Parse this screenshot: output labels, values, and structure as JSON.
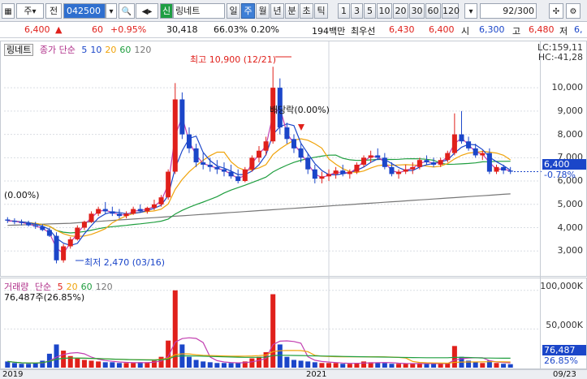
{
  "toolbar": {
    "market": "주",
    "mode": "전",
    "code": "042500",
    "badge": "신",
    "name": "링네트",
    "periods": [
      "일",
      "주",
      "월",
      "년",
      "분",
      "초",
      "틱"
    ],
    "active_period": "주",
    "units": [
      "1",
      "3",
      "5",
      "10",
      "20",
      "30",
      "60",
      "120"
    ],
    "count": "92",
    "count_total": "/300"
  },
  "quote": {
    "price": "6,400",
    "change": "60",
    "change_pct": "+0.95%",
    "volume": "30,418",
    "ratio": "66.03%",
    "turnover": "0.20%",
    "amount": "194백만",
    "best_ask_label": "최우선",
    "best_ask": "6,430",
    "best_bid": "6,400",
    "open_label": "시",
    "open": "6,300",
    "high_label": "고",
    "high": "6,480",
    "low_label": "저",
    "low": "6,"
  },
  "price_panel": {
    "title": "링네트",
    "legend_main": "종가 단순",
    "ma": [
      {
        "label": "5",
        "color": "#1b46c9"
      },
      {
        "label": "10",
        "color": "#1b46c9"
      },
      {
        "label": "20",
        "color": "#f0a30a"
      },
      {
        "label": "60",
        "color": "#1f9e3f"
      },
      {
        "label": "120",
        "color": "#777777"
      }
    ],
    "y_ticks": [
      "10,000",
      "9,000",
      "8,000",
      "7,000",
      "6,000",
      "5,000",
      "4,000",
      "3,000"
    ],
    "lc": "LC:159,11",
    "hc": "HC:-41,28",
    "current_price_tag": "6,400",
    "current_pct_tag": "-0.78%",
    "high_note": "최고 10,900 (12/21)",
    "low_note": "최저 2,470 (03/16)",
    "dividend_note": "배당락(0.00%)",
    "left_note": "(0.00%)"
  },
  "volume_panel": {
    "title": "거래량",
    "legend_main": "단순",
    "ma": [
      {
        "label": "5",
        "color": "#e0201b"
      },
      {
        "label": "20",
        "color": "#f0a30a"
      },
      {
        "label": "60",
        "color": "#1f9e3f"
      },
      {
        "label": "120",
        "color": "#777777"
      }
    ],
    "current_volume": "76,487주(26.85%)",
    "y_ticks": [
      "100,000K",
      "50,000K"
    ],
    "tag_value": "76,487",
    "tag_pct": "26.85%"
  },
  "x_axis": {
    "labels": [
      "2019",
      "2021",
      "09/23"
    ]
  },
  "chart_data": {
    "type": "candlestick",
    "candles": [
      [
        4350,
        4450,
        4200,
        4300
      ],
      [
        4300,
        4400,
        4150,
        4250
      ],
      [
        4250,
        4350,
        4100,
        4200
      ],
      [
        4200,
        4300,
        4050,
        4100
      ],
      [
        4100,
        4250,
        3950,
        4050
      ],
      [
        4050,
        4150,
        3850,
        3900
      ],
      [
        3900,
        4000,
        3600,
        3650
      ],
      [
        3650,
        3800,
        2470,
        2600
      ],
      [
        2600,
        3300,
        2500,
        3200
      ],
      [
        3200,
        3600,
        3100,
        3500
      ],
      [
        3500,
        4100,
        3450,
        4000
      ],
      [
        4000,
        4300,
        3900,
        4250
      ],
      [
        4250,
        4700,
        4200,
        4600
      ],
      [
        4600,
        4900,
        4500,
        4800
      ],
      [
        4800,
        5100,
        4600,
        4700
      ],
      [
        4700,
        4900,
        4500,
        4600
      ],
      [
        4600,
        4800,
        4400,
        4500
      ],
      [
        4500,
        4700,
        4400,
        4600
      ],
      [
        4600,
        4900,
        4550,
        4800
      ],
      [
        4800,
        5000,
        4650,
        4700
      ],
      [
        4700,
        4900,
        4600,
        4850
      ],
      [
        4850,
        5200,
        4750,
        5000
      ],
      [
        5000,
        5400,
        4900,
        5300
      ],
      [
        5300,
        6500,
        5200,
        6400
      ],
      [
        6400,
        10200,
        6300,
        9500
      ],
      [
        9500,
        9800,
        7800,
        8000
      ],
      [
        8000,
        8300,
        7200,
        7400
      ],
      [
        7400,
        7600,
        6600,
        6800
      ],
      [
        6800,
        7200,
        6500,
        6700
      ],
      [
        6700,
        7000,
        6400,
        6600
      ],
      [
        6600,
        6900,
        6300,
        6500
      ],
      [
        6500,
        6800,
        6200,
        6400
      ],
      [
        6400,
        6700,
        6100,
        6200
      ],
      [
        6200,
        6500,
        5900,
        6000
      ],
      [
        6000,
        6600,
        5950,
        6500
      ],
      [
        6500,
        7100,
        6400,
        7000
      ],
      [
        7000,
        7500,
        6800,
        7300
      ],
      [
        7300,
        7900,
        7100,
        7700
      ],
      [
        7700,
        10900,
        7600,
        10000
      ],
      [
        10000,
        10400,
        8000,
        8300
      ],
      [
        8300,
        8500,
        7600,
        7800
      ],
      [
        7800,
        8000,
        7200,
        7400
      ],
      [
        7400,
        7600,
        6800,
        7000
      ],
      [
        7000,
        7200,
        6300,
        6500
      ],
      [
        6500,
        6700,
        5900,
        6100
      ],
      [
        6100,
        6400,
        5900,
        6200
      ],
      [
        6200,
        6500,
        6000,
        6300
      ],
      [
        6300,
        6600,
        6100,
        6450
      ],
      [
        6450,
        6700,
        6200,
        6300
      ],
      [
        6300,
        6500,
        6100,
        6400
      ],
      [
        6400,
        6800,
        6300,
        6700
      ],
      [
        6700,
        7100,
        6600,
        7000
      ],
      [
        7000,
        7300,
        6800,
        7100
      ],
      [
        7100,
        7400,
        6900,
        7000
      ],
      [
        7000,
        7200,
        6500,
        6600
      ],
      [
        6600,
        6800,
        6200,
        6300
      ],
      [
        6300,
        6500,
        6100,
        6400
      ],
      [
        6400,
        6700,
        6300,
        6500
      ],
      [
        6500,
        6800,
        6300,
        6600
      ],
      [
        6600,
        7000,
        6500,
        6900
      ],
      [
        6900,
        7100,
        6700,
        6800
      ],
      [
        6800,
        7000,
        6600,
        6700
      ],
      [
        6700,
        7000,
        6600,
        6900
      ],
      [
        6900,
        7300,
        6800,
        7200
      ],
      [
        7200,
        8900,
        7100,
        8000
      ],
      [
        8000,
        9000,
        7600,
        7700
      ],
      [
        7700,
        7900,
        7300,
        7400
      ],
      [
        7400,
        7600,
        7000,
        7100
      ],
      [
        7100,
        7300,
        6900,
        7200
      ],
      [
        7200,
        7400,
        6300,
        6400
      ],
      [
        6400,
        6700,
        6300,
        6600
      ],
      [
        6600,
        6700,
        6300,
        6450
      ],
      [
        6450,
        6600,
        6300,
        6400
      ]
    ],
    "volumes_k": [
      8000,
      6000,
      5000,
      5000,
      6000,
      9000,
      18000,
      30000,
      22000,
      15000,
      12000,
      10000,
      9000,
      8000,
      7000,
      7000,
      6000,
      6000,
      6000,
      7000,
      7000,
      9000,
      14000,
      35000,
      100000,
      30000,
      14000,
      10000,
      8000,
      7000,
      6000,
      6000,
      6000,
      6000,
      8000,
      12000,
      14000,
      20000,
      95000,
      30000,
      14000,
      10000,
      9000,
      8000,
      7000,
      6000,
      6000,
      6000,
      5000,
      5000,
      6000,
      8000,
      7000,
      6000,
      6000,
      5000,
      5000,
      5000,
      5000,
      6000,
      5000,
      5000,
      5000,
      6000,
      28000,
      14000,
      9000,
      7000,
      6000,
      9000,
      6000,
      5000,
      4500
    ],
    "ylim_price": [
      2000,
      11500
    ],
    "ylim_volume": [
      0,
      105000
    ]
  }
}
